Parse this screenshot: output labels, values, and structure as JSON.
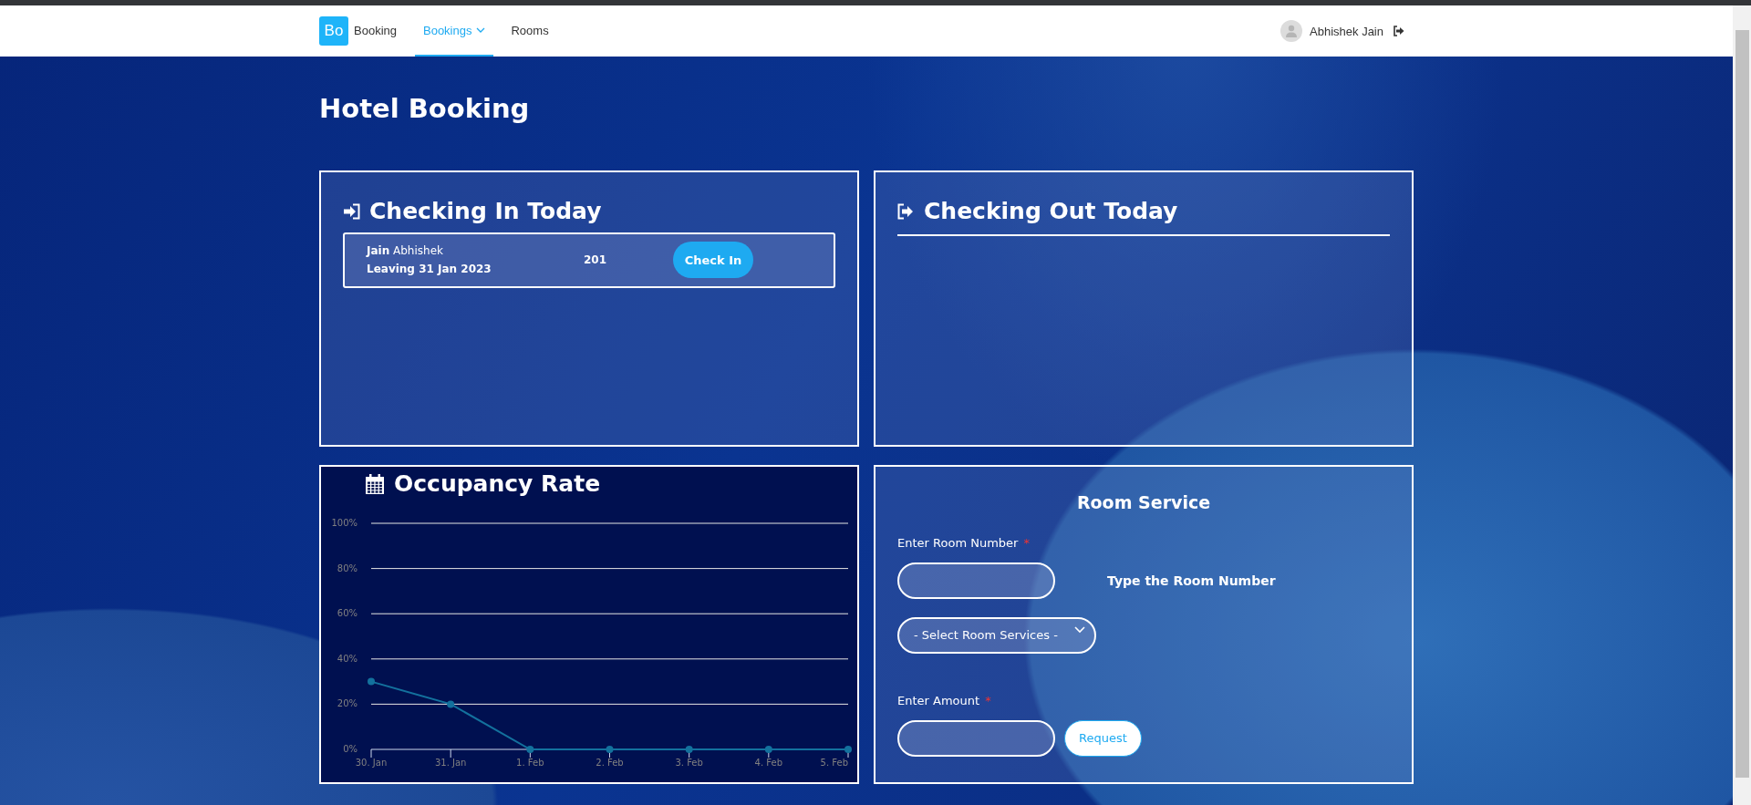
{
  "navbar": {
    "logo": "Bo",
    "brand": "Booking",
    "links": [
      {
        "label": "Bookings",
        "selected": true,
        "dropdown": true
      },
      {
        "label": "Rooms",
        "selected": false,
        "dropdown": false
      }
    ],
    "user": {
      "name": "Abhishek Jain"
    }
  },
  "page_title": "Hotel Booking",
  "checking_in": {
    "title": "Checking In Today",
    "rows": [
      {
        "last_name": "Jain",
        "first_name": "Abhishek",
        "leaving": "Leaving 31 Jan 2023",
        "room": "201",
        "button": "Check In"
      }
    ]
  },
  "checking_out": {
    "title": "Checking Out Today"
  },
  "occupancy": {
    "title": "Occupancy Rate",
    "chart_data": {
      "type": "line",
      "categories": [
        "30. Jan",
        "31. Jan",
        "1. Feb",
        "2. Feb",
        "3. Feb",
        "4. Feb",
        "5. Feb"
      ],
      "grid": true,
      "series": [
        {
          "color": "#13719d",
          "marker": true,
          "values": [
            30,
            20,
            0,
            0,
            0,
            0,
            0
          ]
        }
      ],
      "ylim": [
        0,
        100
      ],
      "yticks": [
        {
          "value": 0,
          "label": "0%"
        },
        {
          "value": 20,
          "label": "20%"
        },
        {
          "value": 40,
          "label": "40%"
        },
        {
          "value": 60,
          "label": "60%"
        },
        {
          "value": 80,
          "label": "80%"
        },
        {
          "value": 100,
          "label": "100%"
        }
      ]
    }
  },
  "room_service": {
    "title": "Room Service",
    "room_label": "Enter Room Number",
    "room_required": "*",
    "room_hint": "Type the Room Number",
    "service_select": "- Select Room Services -",
    "amount_label": "Enter Amount",
    "amount_required": "*",
    "button": "Request"
  }
}
